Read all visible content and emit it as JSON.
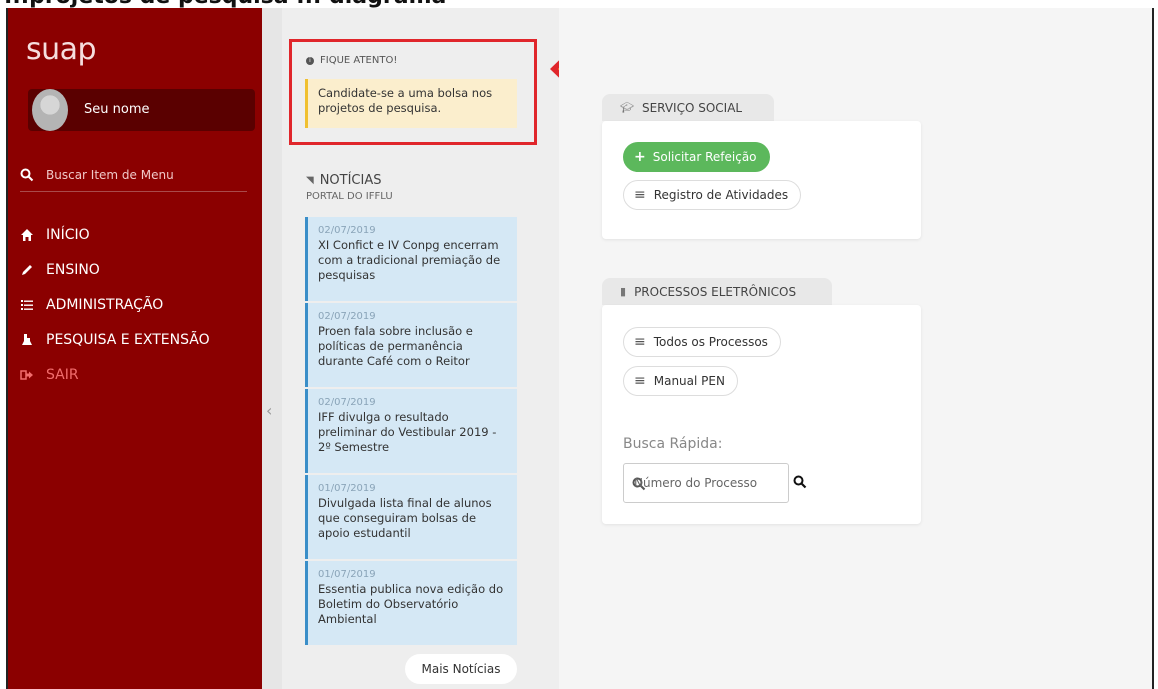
{
  "header_cut_text": "...projetos de pesquisa ... diagrama",
  "sidebar": {
    "logo": "suap",
    "user_name": "Seu nome",
    "search_placeholder": "Buscar Item de Menu",
    "menu": [
      {
        "label": "INÍCIO",
        "icon": "home-icon"
      },
      {
        "label": "ENSINO",
        "icon": "pencil-icon"
      },
      {
        "label": "ADMINISTRAÇÃO",
        "icon": "list-icon"
      },
      {
        "label": "PESQUISA E EXTENSÃO",
        "icon": "flask-icon"
      },
      {
        "label": "SAIR",
        "icon": "sign-out-icon"
      }
    ],
    "colors": {
      "bg": "#8b0000",
      "sair": "#f26d6d"
    }
  },
  "alert": {
    "title": "FIQUE ATENTO!",
    "message": "Candidate-se a uma bolsa nos projetos de pesquisa."
  },
  "news": {
    "title": "NOTÍCIAS",
    "subtitle": "PORTAL DO IFFLU",
    "items": [
      {
        "date": "02/07/2019",
        "text": "XI Confict e IV Conpg encerram com a tradicional premiação de pesquisas"
      },
      {
        "date": "02/07/2019",
        "text": "Proen fala sobre inclusão e políticas de permanência durante Café com o Reitor"
      },
      {
        "date": "02/07/2019",
        "text": "IFF divulga o resultado preliminar do Vestibular 2019 - 2º Semestre"
      },
      {
        "date": "01/07/2019",
        "text": "Divulgada lista final de alunos que conseguiram bolsas de apoio estudantil"
      },
      {
        "date": "01/07/2019",
        "text": "Essentia publica nova edição do Boletim do Observatório Ambiental"
      }
    ],
    "more_label": "Mais Notícias"
  },
  "servico_social": {
    "tab_label": "SERVIÇO SOCIAL",
    "buttons": [
      "Solicitar Refeição",
      "Registro de Atividades"
    ]
  },
  "processos": {
    "tab_label": "PROCESSOS ELETRÔNICOS",
    "buttons": [
      "Todos os Processos",
      "Manual PEN"
    ],
    "busca_label": "Busca Rápida:",
    "busca_placeholder": "Número do Processo"
  }
}
